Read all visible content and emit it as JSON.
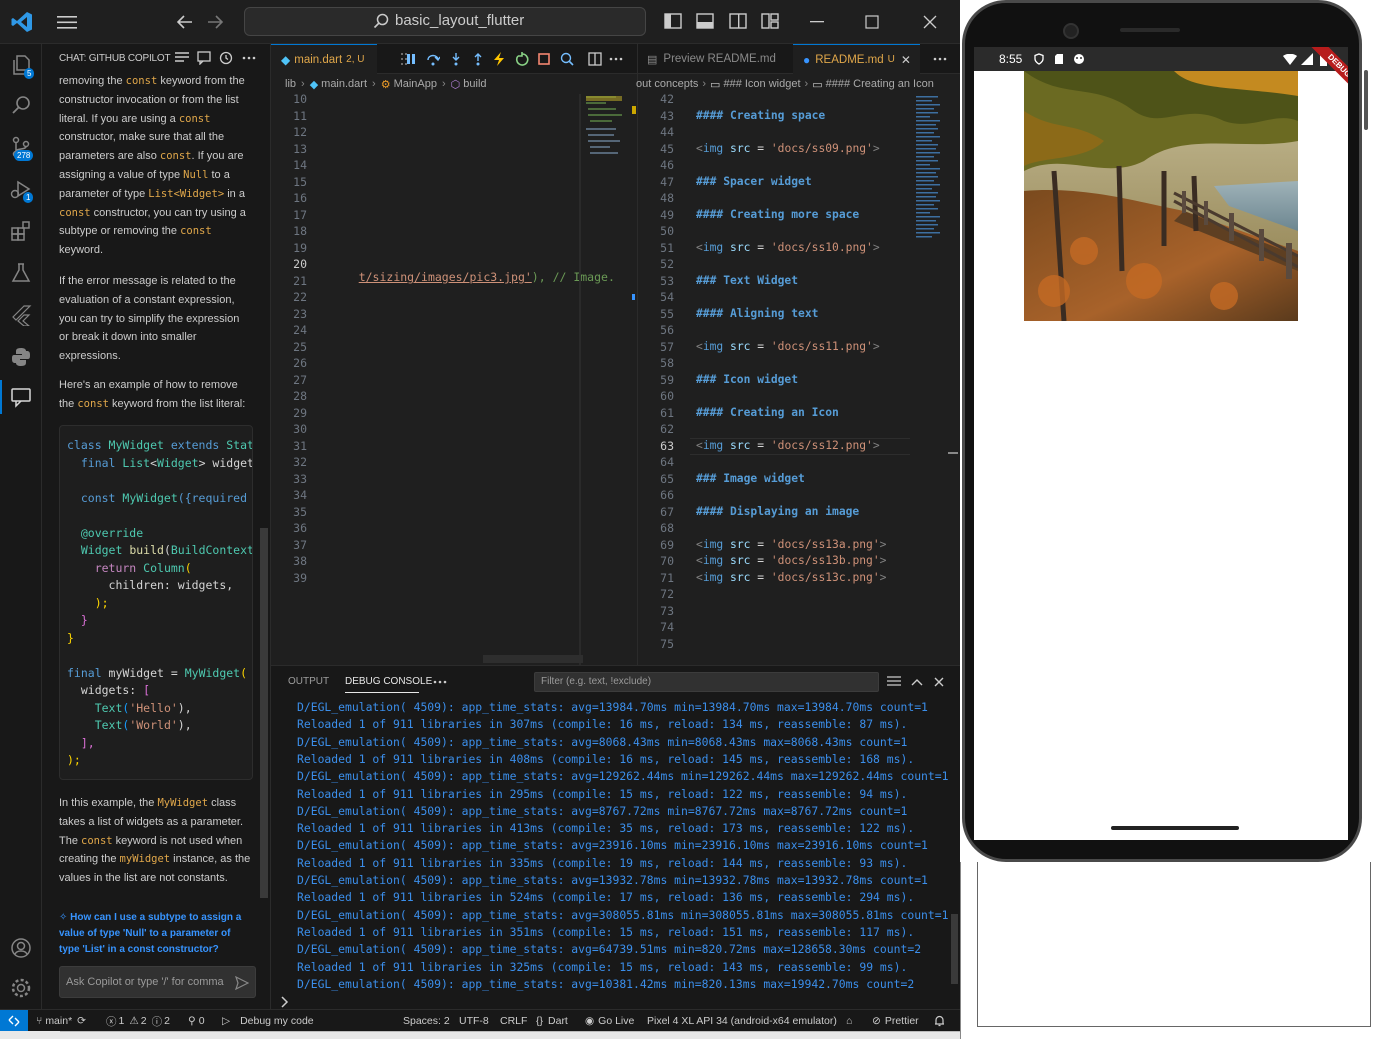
{
  "title_bar": {
    "search_text": "basic_layout_flutter"
  },
  "activity": {
    "explorer_badge": "5",
    "scm_badge": "278",
    "debug_badge": "1"
  },
  "chat": {
    "title": "CHAT: GITHUB COPILOT",
    "lines1": [
      [
        [
          "removing the ",
          ""
        ],
        [
          "const",
          "kw"
        ],
        [
          " keyword from the",
          ""
        ]
      ],
      [
        [
          "constructor invocation or from the list",
          ""
        ]
      ],
      [
        [
          "literal. If you are using a ",
          ""
        ],
        [
          "const",
          "kw"
        ]
      ],
      [
        [
          "constructor, make sure that all the",
          ""
        ]
      ],
      [
        [
          "parameters are also ",
          ""
        ],
        [
          "const",
          "kw"
        ],
        [
          ". If you are",
          ""
        ]
      ],
      [
        [
          "assigning a value of type ",
          ""
        ],
        [
          "Null",
          "kw"
        ],
        [
          " to a",
          ""
        ]
      ],
      [
        [
          "parameter of type ",
          ""
        ],
        [
          "List<Widget>",
          "kw"
        ],
        [
          " in a",
          ""
        ]
      ],
      [
        [
          "const",
          "kw"
        ],
        [
          " constructor, you can try using a",
          ""
        ]
      ],
      [
        [
          "subtype or removing the ",
          ""
        ],
        [
          "const",
          "kw"
        ]
      ],
      [
        [
          "keyword.",
          ""
        ]
      ]
    ],
    "lines2": [
      [
        [
          "If the error message is related to the",
          ""
        ]
      ],
      [
        [
          "evaluation of a constant expression,",
          ""
        ]
      ],
      [
        [
          "you can try to simplify the expression",
          ""
        ]
      ],
      [
        [
          "or break it down into smaller",
          ""
        ]
      ],
      [
        [
          "expressions.",
          ""
        ]
      ]
    ],
    "lines3": [
      [
        [
          "Here's an example of how to remove",
          ""
        ]
      ],
      [
        [
          "the ",
          ""
        ],
        [
          "const",
          "kw"
        ],
        [
          " keyword from the list literal:",
          ""
        ]
      ]
    ],
    "code": [
      [
        [
          "class ",
          "#569cd6"
        ],
        [
          "MyWidget ",
          "#4ec9b0"
        ],
        [
          "extends ",
          "#569cd6"
        ],
        [
          "State",
          "#4ec9b0"
        ]
      ],
      [
        [
          "  final ",
          "#569cd6"
        ],
        [
          "List",
          "#4ec9b0"
        ],
        [
          "<",
          "#d4d4d4"
        ],
        [
          "Widget",
          "#4ec9b0"
        ],
        [
          "> widgets",
          "#d4d4d4"
        ]
      ],
      [
        [
          "",
          ""
        ]
      ],
      [
        [
          "  const ",
          "#569cd6"
        ],
        [
          "MyWidget",
          "#4ec9b0"
        ],
        [
          "({required t",
          "#569cd6"
        ]
      ],
      [
        [
          "",
          ""
        ]
      ],
      [
        [
          "  @override",
          "#4ec9b0"
        ]
      ],
      [
        [
          "  Widget ",
          "#4ec9b0"
        ],
        [
          "build",
          "#dcdcaa"
        ],
        [
          "(",
          "#d4d4d4"
        ],
        [
          "BuildContext",
          "#4ec9b0"
        ]
      ],
      [
        [
          "    return ",
          "#c586c0"
        ],
        [
          "Column",
          "#4ec9b0"
        ],
        [
          "(",
          "#ffd700"
        ]
      ],
      [
        [
          "      children: widgets,",
          "#d4d4d4"
        ]
      ],
      [
        [
          "    );",
          "#ffd700"
        ]
      ],
      [
        [
          "  }",
          "#da70d6"
        ]
      ],
      [
        [
          "}",
          "#ffd700"
        ]
      ],
      [
        [
          "",
          ""
        ]
      ],
      [
        [
          "final ",
          "#569cd6"
        ],
        [
          "myWidget = ",
          "#d4d4d4"
        ],
        [
          "MyWidget",
          "#4ec9b0"
        ],
        [
          "(",
          "#ffd700"
        ]
      ],
      [
        [
          "  widgets: ",
          "#d4d4d4"
        ],
        [
          "[",
          "#da70d6"
        ]
      ],
      [
        [
          "    Text",
          "#4ec9b0"
        ],
        [
          "(",
          "#179fff"
        ],
        [
          "'Hello'",
          "#ce9178"
        ],
        [
          "),",
          "#d4d4d4"
        ]
      ],
      [
        [
          "    Text",
          "#4ec9b0"
        ],
        [
          "(",
          "#179fff"
        ],
        [
          "'World'",
          "#ce9178"
        ],
        [
          "),",
          "#d4d4d4"
        ]
      ],
      [
        [
          "  ],",
          "#da70d6"
        ]
      ],
      [
        [
          ");",
          "#ffd700"
        ]
      ]
    ],
    "lines4": [
      [
        [
          "In this example, the ",
          ""
        ],
        [
          "MyWidget",
          "kw"
        ],
        [
          " class",
          ""
        ]
      ],
      [
        [
          "takes a list of widgets as a parameter.",
          ""
        ]
      ],
      [
        [
          "The ",
          ""
        ],
        [
          "const",
          "kw"
        ],
        [
          " keyword is not used when",
          ""
        ]
      ],
      [
        [
          "creating the ",
          ""
        ],
        [
          "myWidget",
          "kw"
        ],
        [
          " instance, as the",
          ""
        ]
      ],
      [
        [
          "values in the list are not constants.",
          ""
        ]
      ]
    ],
    "followup": [
      "How can I use a subtype to assign a",
      "value of type 'Null' to a parameter of",
      "type 'List' in a const constructor?"
    ],
    "input_placeholder": "Ask Copilot or type '/' for comma"
  },
  "editor1": {
    "tab_name": "main.dart",
    "tab_status": "2, U",
    "breadcrumb": [
      "lib",
      "main.dart",
      "MainApp",
      "build"
    ],
    "line_start": 10,
    "line_end": 39,
    "current_line": 20,
    "code_line_20_link": "t/sizing/images/pic3.jpg'",
    "code_line_20_rest": "), // Image."
  },
  "editor2": {
    "tab_preview": "Preview README.md",
    "tab_active": "README.md",
    "tab_active_status": "U",
    "breadcrumb": [
      "out concepts",
      "### Icon widget",
      "#### Creating an Icon"
    ],
    "line_start": 42,
    "line_end": 75,
    "current_line": 63,
    "lines": {
      "43": "#### Creating space",
      "45": "<img src = 'docs/ss09.png'>",
      "47": "### Spacer widget",
      "49": "#### Creating more space",
      "51": "<img src = 'docs/ss10.png'>",
      "53": "### Text Widget",
      "55": "#### Aligning text",
      "57": "<img src = 'docs/ss11.png'>",
      "59": "### Icon widget",
      "61": "#### Creating an Icon",
      "63": "<img src = 'docs/ss12.png'>",
      "65": "### Image widget",
      "67": "#### Displaying an image",
      "69": "<img src = 'docs/ss13a.png'>",
      "70": "<img src = 'docs/ss13b.png'>",
      "71": "<img src = 'docs/ss13c.png'>"
    }
  },
  "panel": {
    "tab_output": "OUTPUT",
    "tab_debug": "DEBUG CONSOLE",
    "filter_placeholder": "Filter (e.g. text, !exclude)",
    "logs": [
      "D/EGL_emulation( 4509): app_time_stats: avg=13984.70ms min=13984.70ms max=13984.70ms count=1",
      "Reloaded 1 of 911 libraries in 307ms (compile: 16 ms, reload: 134 ms, reassemble: 87 ms).",
      "D/EGL_emulation( 4509): app_time_stats: avg=8068.43ms min=8068.43ms max=8068.43ms count=1",
      "Reloaded 1 of 911 libraries in 408ms (compile: 16 ms, reload: 145 ms, reassemble: 168 ms).",
      "D/EGL_emulation( 4509): app_time_stats: avg=129262.44ms min=129262.44ms max=129262.44ms count=1",
      "Reloaded 1 of 911 libraries in 295ms (compile: 15 ms, reload: 122 ms, reassemble: 94 ms).",
      "D/EGL_emulation( 4509): app_time_stats: avg=8767.72ms min=8767.72ms max=8767.72ms count=1",
      "Reloaded 1 of 911 libraries in 413ms (compile: 35 ms, reload: 173 ms, reassemble: 122 ms).",
      "D/EGL_emulation( 4509): app_time_stats: avg=23916.10ms min=23916.10ms max=23916.10ms count=1",
      "Reloaded 1 of 911 libraries in 335ms (compile: 19 ms, reload: 144 ms, reassemble: 93 ms).",
      "D/EGL_emulation( 4509): app_time_stats: avg=13932.78ms min=13932.78ms max=13932.78ms count=1",
      "Reloaded 1 of 911 libraries in 524ms (compile: 17 ms, reload: 136 ms, reassemble: 294 ms).",
      "D/EGL_emulation( 4509): app_time_stats: avg=308055.81ms min=308055.81ms max=308055.81ms count=1",
      "Reloaded 1 of 911 libraries in 351ms (compile: 15 ms, reload: 151 ms, reassemble: 117 ms).",
      "D/EGL_emulation( 4509): app_time_stats: avg=64739.51ms min=820.72ms max=128658.30ms count=2",
      "Reloaded 1 of 911 libraries in 325ms (compile: 15 ms, reload: 143 ms, reassemble: 99 ms).",
      "D/EGL_emulation( 4509): app_time_stats: avg=10381.42ms min=820.13ms max=19942.70ms count=2"
    ]
  },
  "status": {
    "branch": "main*",
    "errors": "1",
    "warnings": "2",
    "infos": "2",
    "ports": "0",
    "debug": "Debug my code",
    "spaces": "Spaces: 2",
    "encoding": "UTF-8",
    "eol": "CRLF",
    "language": "Dart",
    "golive": "Go Live",
    "device": "Pixel 4 XL API 34 (android-x64 emulator)",
    "prettier": "Prettier"
  },
  "phone": {
    "time": "8:55",
    "debug_banner": "DEBUG"
  }
}
